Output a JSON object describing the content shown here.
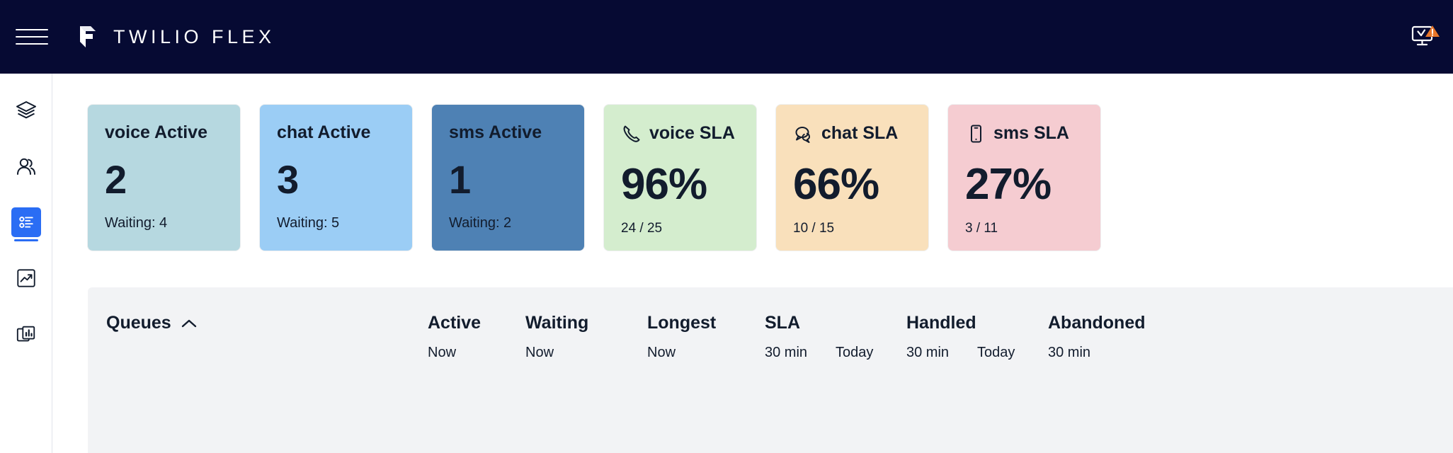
{
  "header": {
    "menu_icon": "hamburger-menu-icon",
    "brand_mark": "twilio-logo-mark",
    "brand_text": "TWILIO FLEX",
    "status_icon": "monitor-warning-icon",
    "background_color": "#060a33"
  },
  "sidebar": {
    "items": [
      {
        "icon": "layers-icon",
        "name": "sidebar-item-layers",
        "active": false
      },
      {
        "icon": "agents-icon",
        "name": "sidebar-item-agents",
        "active": false
      },
      {
        "icon": "queues-icon",
        "name": "sidebar-item-queues",
        "active": true
      },
      {
        "icon": "trend-up-icon",
        "name": "sidebar-item-insights",
        "active": false
      },
      {
        "icon": "bar-chart-icon",
        "name": "sidebar-item-reports",
        "active": false
      }
    ],
    "active_color": "#2a6df4"
  },
  "cards": [
    {
      "id": "voice-active",
      "title": "voice Active",
      "icon": null,
      "value": "2",
      "sub": "Waiting: 4",
      "bg": "#b6d8e0"
    },
    {
      "id": "chat-active",
      "title": "chat Active",
      "icon": null,
      "value": "3",
      "sub": "Waiting: 5",
      "bg": "#9bcdf5"
    },
    {
      "id": "sms-active",
      "title": "sms Active",
      "icon": null,
      "value": "1",
      "sub": "Waiting: 2",
      "bg": "#4e81b4"
    },
    {
      "id": "voice-sla",
      "title": "voice SLA",
      "icon": "phone-icon",
      "value": "96%",
      "sub": "24 / 25",
      "bg": "#d4edce"
    },
    {
      "id": "chat-sla",
      "title": "chat SLA",
      "icon": "chat-bubbles-icon",
      "value": "66%",
      "sub": "10 / 15",
      "bg": "#f9e0bb"
    },
    {
      "id": "sms-sla",
      "title": "sms SLA",
      "icon": "mobile-phone-icon",
      "value": "27%",
      "sub": "3 / 11",
      "bg": "#f5ccd1"
    }
  ],
  "table": {
    "queues_label": "Queues",
    "sort_icon": "chevron-up-icon",
    "columns": [
      {
        "label": "Active",
        "subs": [
          "Now"
        ]
      },
      {
        "label": "Waiting",
        "subs": [
          "Now"
        ]
      },
      {
        "label": "Longest",
        "subs": [
          "Now"
        ]
      },
      {
        "label": "SLA",
        "subs": [
          "30 min",
          "Today"
        ]
      },
      {
        "label": "Handled",
        "subs": [
          "30 min",
          "Today"
        ]
      },
      {
        "label": "Abandoned",
        "subs": [
          "30 min"
        ]
      }
    ],
    "background_color": "#f2f3f5"
  }
}
